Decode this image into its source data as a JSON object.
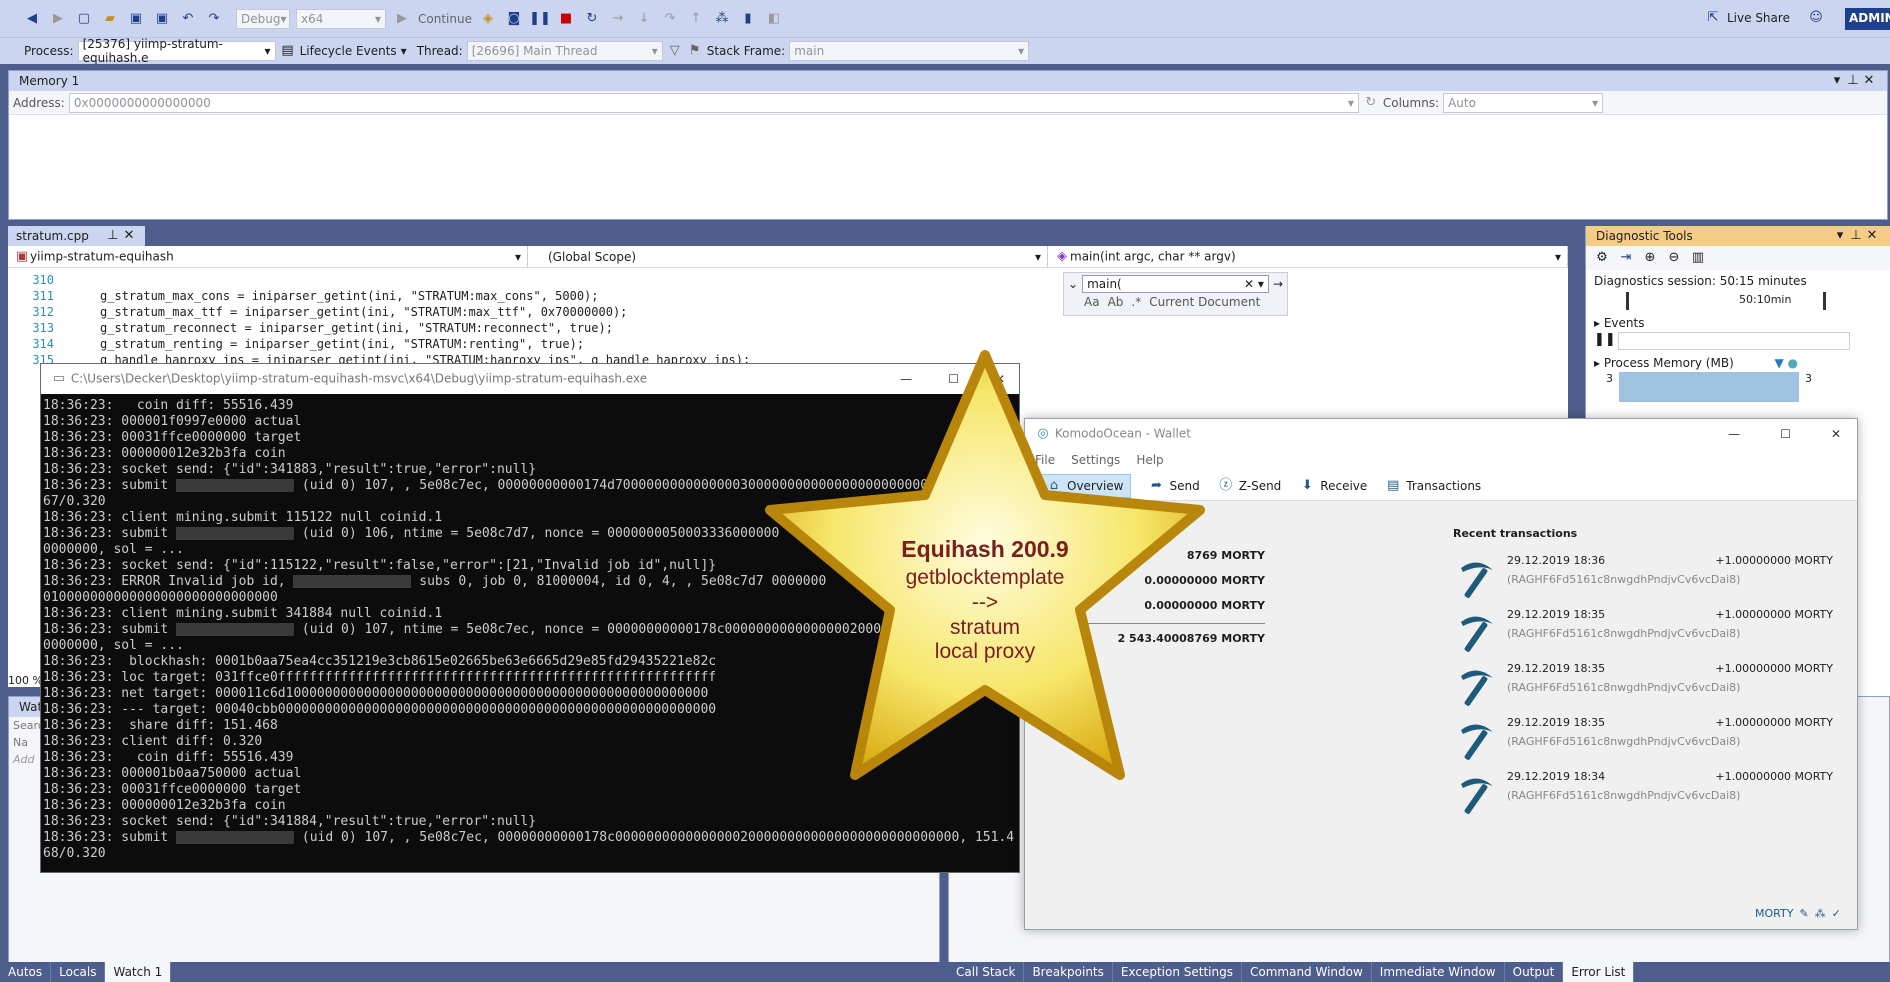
{
  "toolbar": {
    "config": "Debug",
    "platform": "x64",
    "continue": "Continue",
    "live_share": "Live Share",
    "user": "ADMIN",
    "process_label": "Process:",
    "process_value": "[25376] yiimp-stratum-equihash.e",
    "lifecycle": "Lifecycle Events",
    "thread_label": "Thread:",
    "thread_value": "[26696] Main Thread",
    "stack_label": "Stack Frame:",
    "stack_value": "main"
  },
  "memory": {
    "title": "Memory 1",
    "address_label": "Address:",
    "address_value": "0x0000000000000000",
    "columns_label": "Columns:",
    "columns_value": "Auto"
  },
  "editor": {
    "tab": "stratum.cpp",
    "project": "yiimp-stratum-equihash",
    "scope": "(Global Scope)",
    "function": "main(int argc, char ** argv)",
    "find_value": "main(",
    "find_scope": "Current Document",
    "zoom": "100 %",
    "lines": [
      {
        "n": "310",
        "code": ""
      },
      {
        "n": "311",
        "code": "g_stratum_max_cons = iniparser_getint(ini, \"STRATUM:max_cons\", 5000);"
      },
      {
        "n": "312",
        "code": "g_stratum_max_ttf = iniparser_getint(ini, \"STRATUM:max_ttf\", 0x70000000);"
      },
      {
        "n": "313",
        "code": "g_stratum_reconnect = iniparser_getint(ini, \"STRATUM:reconnect\", true);"
      },
      {
        "n": "314",
        "code": "g_stratum_renting = iniparser_getint(ini, \"STRATUM:renting\", true);"
      },
      {
        "n": "315",
        "code": "g_handle_haproxy_ips = iniparser_getint(ini, \"STRATUM:haproxy_ips\", g_handle_haproxy_ips);"
      }
    ]
  },
  "diag": {
    "title": "Diagnostic Tools",
    "session": "Diagnostics session: 50:15 minutes",
    "time_mark": "50:10min",
    "events": "Events",
    "memory": "Process Memory (MB)",
    "mem_left": "3",
    "mem_right": "3"
  },
  "console": {
    "title": "C:\\Users\\Decker\\Desktop\\yiimp-stratum-equihash-msvc\\x64\\Debug\\yiimp-stratum-equihash.exe",
    "lines": [
      "18:36:23:   coin diff: 55516.439",
      "18:36:23: 000001f0997e0000 actual",
      "18:36:23: 00031ffce0000000 target",
      "18:36:23: 000000012e32b3fa coin",
      "18:36:23: socket send: {\"id\":341883,\"result\":true,\"error\":null}",
      "18:36:23: submit [B] (uid 0) 107, , 5e08c7ec, 00000000000174d7000000000000000300000000000000000000000000000000,",
      "67/0.320",
      "18:36:23: client mining.submit 115122 null coinid.1",
      "18:36:23: submit [B] (uid 0) 106, ntime = 5e08c7d7, nonce = 0000000050003336000000",
      "0000000, sol = ...",
      "18:36:23: socket send: {\"id\":115122,\"result\":false,\"error\":[21,\"Invalid job id\",null]}",
      "18:36:23: ERROR Invalid job id, [B] subs 0, job 0, 81000004, id 0, 4, , 5e08c7d7 0000000",
      "010000000000000000000000000000",
      "18:36:23: client mining.submit 341884 null coinid.1",
      "18:36:23: submit [B] (uid 0) 107, ntime = 5e08c7ec, nonce = 00000000000178c000000000000000020000",
      "0000000, sol = ...",
      "18:36:23:  blockhash: 0001b0aa75ea4cc351219e3cb8615e02665be63e6665d29e85fd29435221e82c",
      "18:36:23: loc target: 031ffce0ffffffffffffffffffffffffffffffffffffffffffffffffffffffff",
      "18:36:23: net target: 000011c6d100000000000000000000000000000000000000000000000000000",
      "18:36:23: --- target: 00040cbb00000000000000000000000000000000000000000000000000000000",
      "18:36:23:  share diff: 151.468",
      "18:36:23: client diff: 0.320",
      "18:36:23:   coin diff: 55516.439",
      "18:36:23: 000001b0aa750000 actual",
      "18:36:23: 00031ffce0000000 target",
      "18:36:23: 000000012e32b3fa coin",
      "18:36:23: socket send: {\"id\":341884,\"result\":true,\"error\":null}",
      "18:36:23: submit [B] (uid 0) 107, , 5e08c7ec, 00000000000178c00000000000000002000000000000000000000000000, 151.4",
      "68/0.320"
    ]
  },
  "star": {
    "line1": "Equihash 200.9",
    "line2": "getblocktemplate",
    "line3": "-->",
    "line4": "stratum",
    "line5": "local proxy"
  },
  "wallet": {
    "title": "KomodoOcean - Wallet",
    "menu": [
      "File",
      "Settings",
      "Help"
    ],
    "tabs": [
      "Overview",
      "Send",
      "Z-Send",
      "Receive",
      "Transactions"
    ],
    "balances": [
      {
        "value": "8769 MORTY"
      },
      {
        "value": "0.00000000 MORTY"
      },
      {
        "value": "0.00000000 MORTY"
      },
      {
        "value": "2 543.40008769 MORTY"
      }
    ],
    "recent_title": "Recent transactions",
    "transactions": [
      {
        "date": "29.12.2019 18:36",
        "amount": "+1.00000000 MORTY",
        "address": "(RAGHF6Fd5161c8nwgdhPndjvCv6vcDai8)"
      },
      {
        "date": "29.12.2019 18:35",
        "amount": "+1.00000000 MORTY",
        "address": "(RAGHF6Fd5161c8nwgdhPndjvCv6vcDai8)"
      },
      {
        "date": "29.12.2019 18:35",
        "amount": "+1.00000000 MORTY",
        "address": "(RAGHF6Fd5161c8nwgdhPndjvCv6vcDai8)"
      },
      {
        "date": "29.12.2019 18:35",
        "amount": "+1.00000000 MORTY",
        "address": "(RAGHF6Fd5161c8nwgdhPndjvCv6vcDai8)"
      },
      {
        "date": "29.12.2019 18:34",
        "amount": "+1.00000000 MORTY",
        "address": "(RAGHF6Fd5161c8nwgdhPndjvCv6vcDai8)"
      }
    ],
    "status_unit": "MORTY"
  },
  "watch": {
    "title": "Watc",
    "search": "Searc",
    "col_name": "Na",
    "add_hint": "Add"
  },
  "bottom_left_tabs": [
    "Autos",
    "Locals",
    "Watch 1"
  ],
  "bottom_right_tabs": [
    "Call Stack",
    "Breakpoints",
    "Exception Settings",
    "Command Window",
    "Immediate Window",
    "Output",
    "Error List"
  ]
}
